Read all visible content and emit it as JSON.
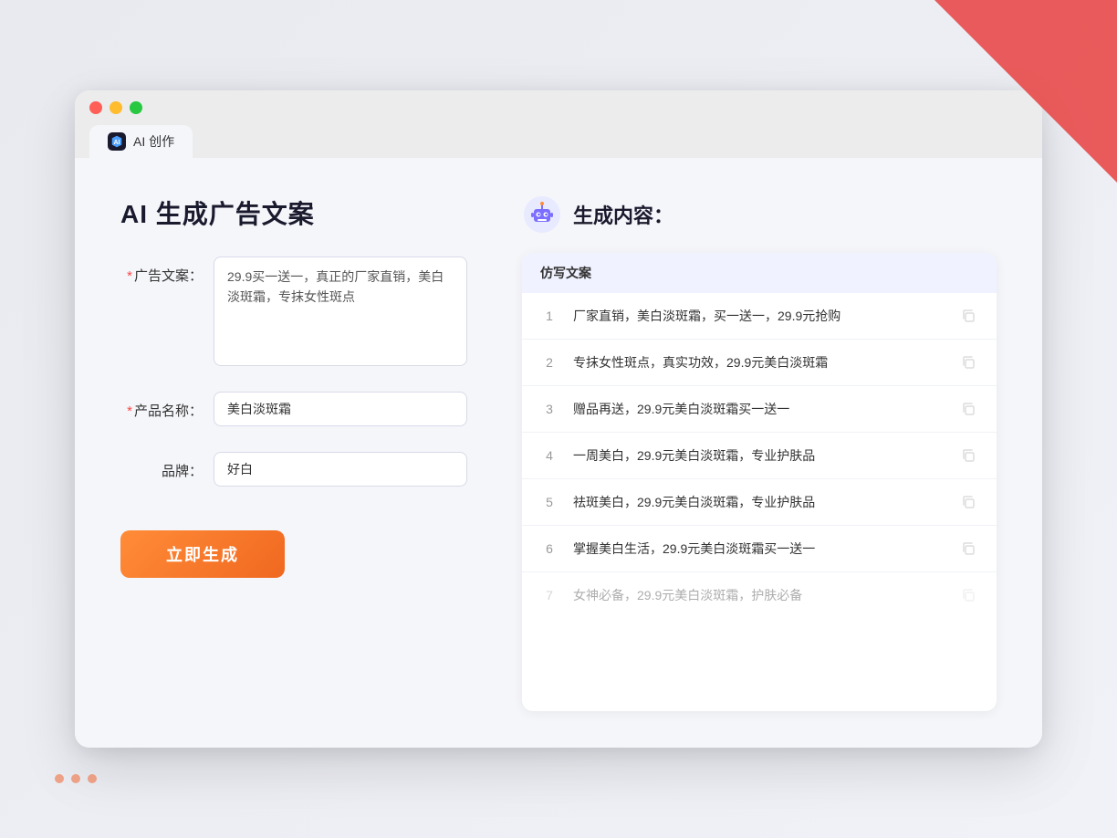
{
  "background": {
    "color": "#e8eaf0"
  },
  "browser": {
    "tab_label": "AI 创作",
    "tab_icon_text": "AI"
  },
  "left_panel": {
    "page_title": "AI 生成广告文案",
    "form": {
      "ad_copy_label": "广告文案：",
      "ad_copy_required": "*",
      "ad_copy_value": "29.9买一送一，真正的厂家直销，美白淡斑霜，专抹女性斑点",
      "product_name_label": "产品名称：",
      "product_name_required": "*",
      "product_name_value": "美白淡斑霜",
      "brand_label": "品牌：",
      "brand_value": "好白"
    },
    "generate_button": "立即生成"
  },
  "right_panel": {
    "title": "生成内容：",
    "results_header": "仿写文案",
    "results": [
      {
        "num": "1",
        "text": "厂家直销，美白淡斑霜，买一送一，29.9元抢购",
        "dimmed": false
      },
      {
        "num": "2",
        "text": "专抹女性斑点，真实功效，29.9元美白淡斑霜",
        "dimmed": false
      },
      {
        "num": "3",
        "text": "赠品再送，29.9元美白淡斑霜买一送一",
        "dimmed": false
      },
      {
        "num": "4",
        "text": "一周美白，29.9元美白淡斑霜，专业护肤品",
        "dimmed": false
      },
      {
        "num": "5",
        "text": "祛斑美白，29.9元美白淡斑霜，专业护肤品",
        "dimmed": false
      },
      {
        "num": "6",
        "text": "掌握美白生活，29.9元美白淡斑霜买一送一",
        "dimmed": false
      },
      {
        "num": "7",
        "text": "女神必备，29.9元美白淡斑霜，护肤必备",
        "dimmed": true
      }
    ]
  }
}
